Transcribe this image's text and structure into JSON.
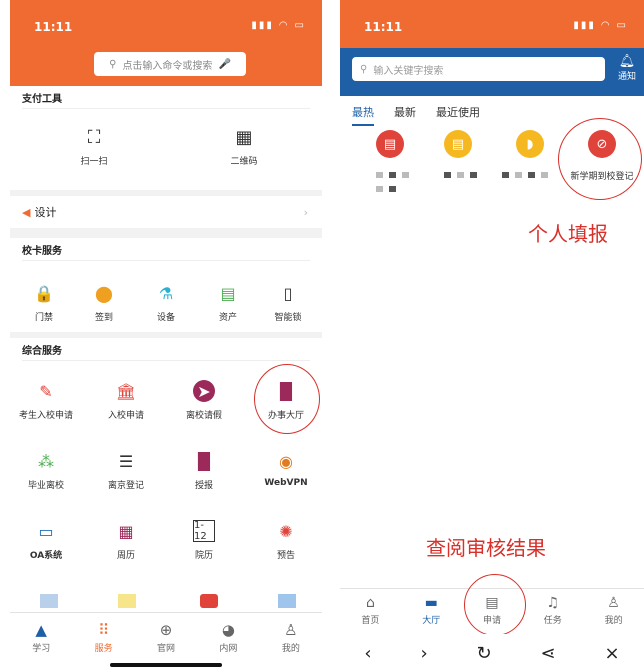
{
  "phone1": {
    "time": "11:11",
    "status_icons": "▮▮▮ ◠ ▭",
    "search_placeholder": "点击输入命令或搜索",
    "sections": {
      "pay_tools": {
        "title": "支付工具",
        "items": [
          "扫一扫",
          "二维码"
        ]
      },
      "design": {
        "label": "设计"
      },
      "campus_card": {
        "title": "校卡服务",
        "items": [
          "门禁",
          "签到",
          "设备",
          "资产",
          "智能锁"
        ]
      },
      "general": {
        "title": "综合服务",
        "items": [
          "考生入校申请",
          "入校申请",
          "离校请假",
          "办事大厅",
          "毕业离校",
          "离京登记",
          "授报",
          "WebVPN",
          "OA系统",
          "周历",
          "院历",
          "预告"
        ]
      }
    },
    "tabs": [
      "学习",
      "服务",
      "官网",
      "内网",
      "我的"
    ],
    "active_tab": "服务"
  },
  "phone2": {
    "time": "11:11",
    "status_icons": "▮▮▮ ◠ ▭",
    "search_placeholder": "输入关键字搜索",
    "notice_label": "通知",
    "tabs": [
      "最热",
      "最新",
      "最近使用"
    ],
    "active_tab": "最热",
    "featured_app": "新学期到校登记",
    "annotation_top": "个人填报",
    "annotation_bottom": "查阅审核结果",
    "bottom_tabs": [
      "首页",
      "大厅",
      "申请",
      "任务",
      "我的"
    ],
    "active_bottom_tab": "大厅"
  },
  "colors": {
    "orange": "#ef6b32",
    "blue": "#1f5fa6",
    "red_annotation": "#d8302a"
  }
}
